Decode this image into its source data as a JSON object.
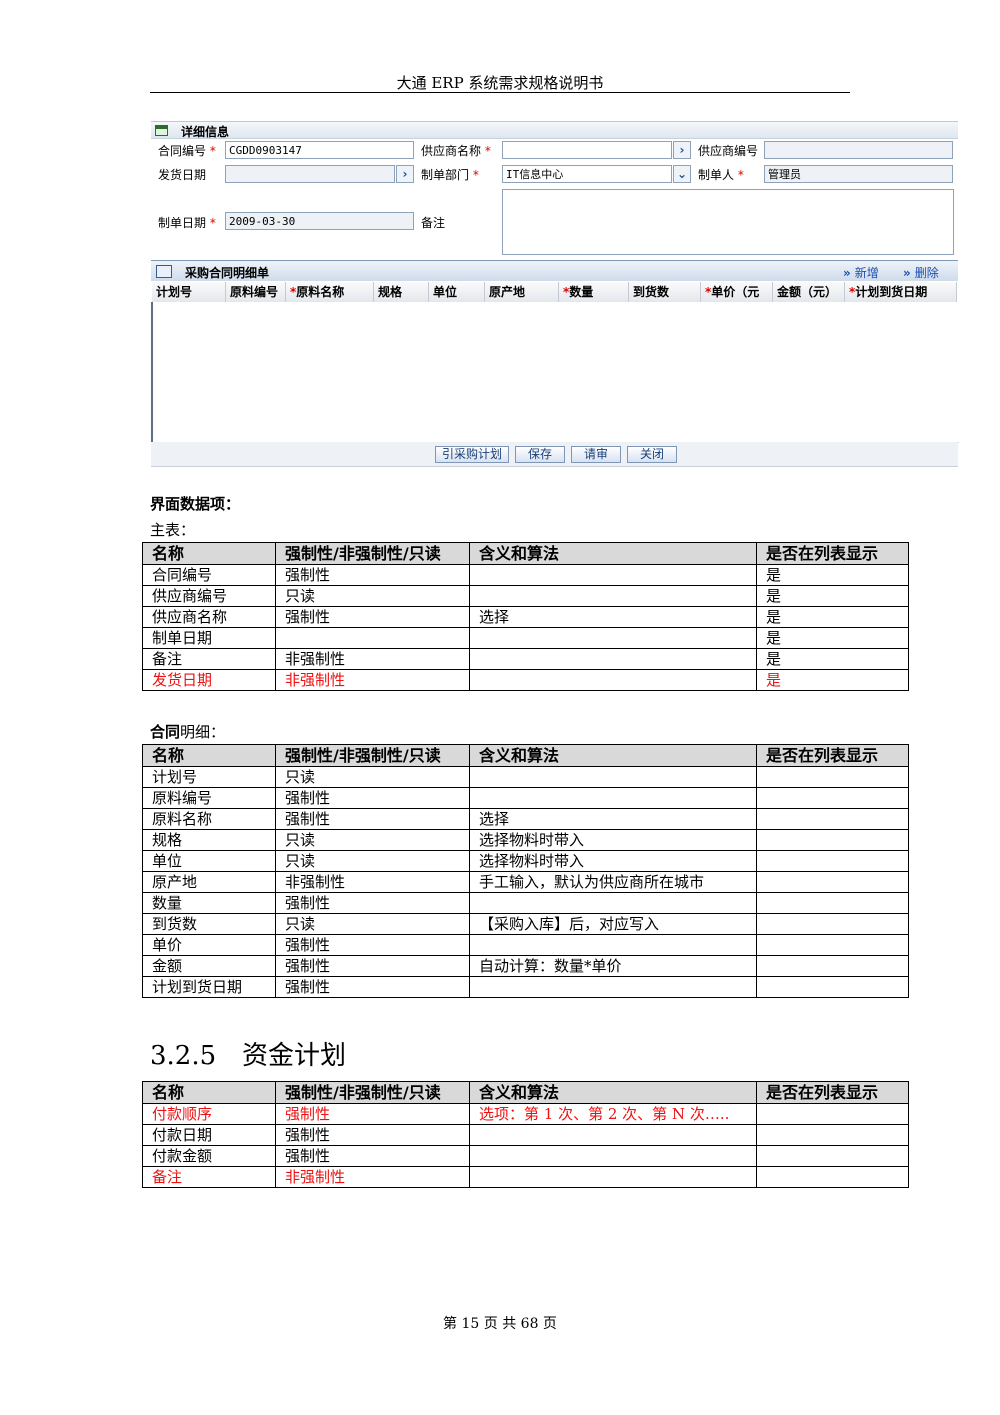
{
  "header": {
    "title": "大通 ERP 系统需求规格说明书"
  },
  "form": {
    "panel_title": "详细信息",
    "fields": {
      "contract_no": {
        "label": "合同编号",
        "value": "CGDD0903147"
      },
      "supplier_name": {
        "label": "供应商名称",
        "value": ""
      },
      "supplier_no": {
        "label": "供应商编号",
        "value": ""
      },
      "ship_date": {
        "label": "发货日期",
        "value": ""
      },
      "dept": {
        "label": "制单部门",
        "value": "IT信息中心"
      },
      "creator": {
        "label": "制单人",
        "value": "管理员"
      },
      "create_date": {
        "label": "制单日期",
        "value": "2009-03-30"
      },
      "remark": {
        "label": "备注",
        "value": ""
      }
    },
    "required_mark": "*",
    "picker_glyph": "›",
    "dropdown_glyph": "⌄"
  },
  "grid": {
    "title": "采购合同明细单",
    "add_label": "新增",
    "delete_label": "删除",
    "action_glyph": "»",
    "columns": [
      {
        "label": "计划号",
        "required": false
      },
      {
        "label": "原料编号",
        "required": false
      },
      {
        "label": "原料名称",
        "required": true
      },
      {
        "label": "规格",
        "required": false
      },
      {
        "label": "单位",
        "required": false
      },
      {
        "label": "原产地",
        "required": false
      },
      {
        "label": "数量",
        "required": true
      },
      {
        "label": "到货数",
        "required": false
      },
      {
        "label": "单价（元",
        "required": true
      },
      {
        "label": "金额（元）",
        "required": false
      },
      {
        "label": "计划到货日期",
        "required": true
      }
    ],
    "buttons": [
      "引采购计划",
      "保存",
      "请审",
      "关闭"
    ]
  },
  "sections": {
    "ui_items_label": "界面数据项：",
    "main_table_label": "主表：",
    "detail_label_bold": "合同",
    "detail_label_rest": "明细：",
    "heading_number": "3.2.5",
    "heading_title": "资金计划"
  },
  "table_headers": [
    "名称",
    "强制性/非强制性/只读",
    "含义和算法",
    "是否在列表显示"
  ],
  "main_table": [
    {
      "cells": [
        "合同编号",
        "强制性",
        "",
        "是"
      ],
      "highlight": false
    },
    {
      "cells": [
        "供应商编号",
        "只读",
        "",
        "是"
      ],
      "highlight": false
    },
    {
      "cells": [
        "供应商名称",
        "强制性",
        "选择",
        "是"
      ],
      "highlight": false
    },
    {
      "cells": [
        "制单日期",
        "",
        "",
        "是"
      ],
      "highlight": false
    },
    {
      "cells": [
        "备注",
        "非强制性",
        "",
        "是"
      ],
      "highlight": false
    },
    {
      "cells": [
        "发货日期",
        "非强制性",
        "",
        "是"
      ],
      "highlight": true
    }
  ],
  "detail_table": [
    {
      "cells": [
        "计划号",
        "只读",
        "",
        ""
      ],
      "highlight": false
    },
    {
      "cells": [
        "原料编号",
        "强制性",
        "",
        ""
      ],
      "highlight": false
    },
    {
      "cells": [
        "原料名称",
        "强制性",
        "选择",
        ""
      ],
      "highlight": false
    },
    {
      "cells": [
        "规格",
        "只读",
        "选择物料时带入",
        ""
      ],
      "highlight": false
    },
    {
      "cells": [
        "单位",
        "只读",
        "选择物料时带入",
        ""
      ],
      "highlight": false
    },
    {
      "cells": [
        "原产地",
        "非强制性",
        "手工输入，默认为供应商所在城市",
        ""
      ],
      "highlight": false
    },
    {
      "cells": [
        "数量",
        "强制性",
        "",
        ""
      ],
      "highlight": false
    },
    {
      "cells": [
        "到货数",
        "只读",
        "【采购入库】后，对应写入",
        ""
      ],
      "highlight": false
    },
    {
      "cells": [
        "单价",
        "强制性",
        "",
        ""
      ],
      "highlight": false
    },
    {
      "cells": [
        "金额",
        "强制性",
        "自动计算：数量*单价",
        ""
      ],
      "highlight": false
    },
    {
      "cells": [
        "计划到货日期",
        "强制性",
        "",
        ""
      ],
      "highlight": false
    }
  ],
  "fund_table": [
    {
      "cells": [
        "付款顺序",
        "强制性",
        "选项：第 1 次、第 2 次、第 N 次…..",
        ""
      ],
      "highlight": true
    },
    {
      "cells": [
        "付款日期",
        "强制性",
        "",
        ""
      ],
      "highlight": false
    },
    {
      "cells": [
        "付款金额",
        "强制性",
        "",
        ""
      ],
      "highlight": false
    },
    {
      "cells": [
        "备注",
        "非强制性",
        "",
        ""
      ],
      "highlight": true
    }
  ],
  "footer": {
    "page_text": "第 15 页 共 68 页"
  },
  "colors": {
    "highlight": "#ee1111",
    "header_bg": "#d9d9d9",
    "link": "#1a4fb0"
  }
}
